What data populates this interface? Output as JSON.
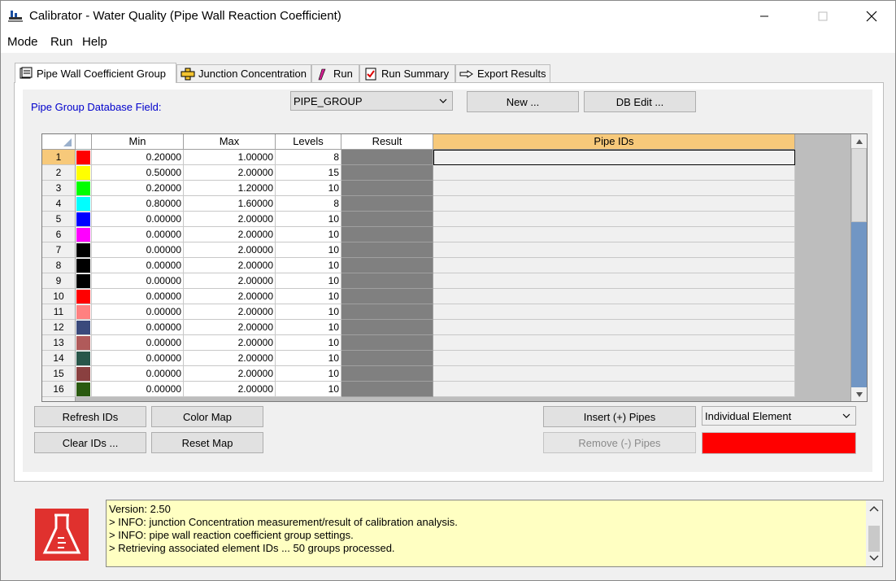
{
  "window": {
    "title": "Calibrator - Water Quality (Pipe Wall Reaction Coefficient)"
  },
  "menu": [
    "Mode",
    "Run",
    "Help"
  ],
  "tabs": [
    {
      "label": "Pipe Wall Coefficient Group",
      "icon": "book-icon",
      "active": true
    },
    {
      "label": "Junction Concentration",
      "icon": "junction-icon",
      "active": false
    },
    {
      "label": "Run",
      "icon": "pencil-run-icon",
      "active": false
    },
    {
      "label": "Run Summary",
      "icon": "checklist-icon",
      "active": false
    },
    {
      "label": "Export Results",
      "icon": "pointing-hand-icon",
      "active": false
    }
  ],
  "group_panel": {
    "field_label": "Pipe Group Database Field:",
    "field_value": "PIPE_GROUP",
    "new_button": "New ...",
    "db_edit_button": "DB Edit ..."
  },
  "grid": {
    "columns": [
      "",
      "",
      "Min",
      "Max",
      "Levels",
      "Result",
      "Pipe IDs"
    ],
    "rows": [
      {
        "n": "1",
        "color": "#ff0000",
        "min": "0.20000",
        "max": "1.00000",
        "levels": "8"
      },
      {
        "n": "2",
        "color": "#ffff00",
        "min": "0.50000",
        "max": "2.00000",
        "levels": "15"
      },
      {
        "n": "3",
        "color": "#00ff00",
        "min": "0.20000",
        "max": "1.20000",
        "levels": "10"
      },
      {
        "n": "4",
        "color": "#00ffff",
        "min": "0.80000",
        "max": "1.60000",
        "levels": "8"
      },
      {
        "n": "5",
        "color": "#0000ff",
        "min": "0.00000",
        "max": "2.00000",
        "levels": "10"
      },
      {
        "n": "6",
        "color": "#ff00ff",
        "min": "0.00000",
        "max": "2.00000",
        "levels": "10"
      },
      {
        "n": "7",
        "color": "#000000",
        "min": "0.00000",
        "max": "2.00000",
        "levels": "10"
      },
      {
        "n": "8",
        "color": "#000000",
        "min": "0.00000",
        "max": "2.00000",
        "levels": "10"
      },
      {
        "n": "9",
        "color": "#000000",
        "min": "0.00000",
        "max": "2.00000",
        "levels": "10"
      },
      {
        "n": "10",
        "color": "#ff0000",
        "min": "0.00000",
        "max": "2.00000",
        "levels": "10"
      },
      {
        "n": "11",
        "color": "#ff8080",
        "min": "0.00000",
        "max": "2.00000",
        "levels": "10"
      },
      {
        "n": "12",
        "color": "#3a4a7c",
        "min": "0.00000",
        "max": "2.00000",
        "levels": "10"
      },
      {
        "n": "13",
        "color": "#b05a5a",
        "min": "0.00000",
        "max": "2.00000",
        "levels": "10"
      },
      {
        "n": "14",
        "color": "#28564a",
        "min": "0.00000",
        "max": "2.00000",
        "levels": "10"
      },
      {
        "n": "15",
        "color": "#8a4040",
        "min": "0.00000",
        "max": "2.00000",
        "levels": "10"
      },
      {
        "n": "16",
        "color": "#2a5a10",
        "min": "0.00000",
        "max": "2.00000",
        "levels": "10"
      }
    ]
  },
  "buttons": {
    "refresh_ids": "Refresh IDs",
    "color_map": "Color Map",
    "clear_ids": "Clear IDs ...",
    "reset_map": "Reset Map",
    "insert_pipes": "Insert (+) Pipes",
    "remove_pipes": "Remove (-) Pipes"
  },
  "selection_mode": {
    "value": "Individual Element",
    "swatch_color": "#ff0000"
  },
  "log": [
    "Version: 2.50",
    "> INFO: junction Concentration measurement/result of calibration analysis.",
    "> INFO: pipe wall reaction coefficient group settings.",
    "> Retrieving associated element IDs ... 50 groups processed."
  ]
}
